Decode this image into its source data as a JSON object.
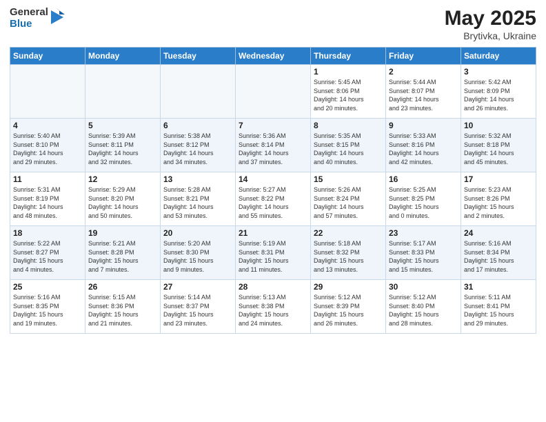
{
  "header": {
    "logo": {
      "general": "General",
      "blue": "Blue"
    },
    "title": "May 2025",
    "location": "Brytivka, Ukraine"
  },
  "weekdays": [
    "Sunday",
    "Monday",
    "Tuesday",
    "Wednesday",
    "Thursday",
    "Friday",
    "Saturday"
  ],
  "weeks": [
    [
      {
        "day": "",
        "info": ""
      },
      {
        "day": "",
        "info": ""
      },
      {
        "day": "",
        "info": ""
      },
      {
        "day": "",
        "info": ""
      },
      {
        "day": "1",
        "info": "Sunrise: 5:45 AM\nSunset: 8:06 PM\nDaylight: 14 hours\nand 20 minutes."
      },
      {
        "day": "2",
        "info": "Sunrise: 5:44 AM\nSunset: 8:07 PM\nDaylight: 14 hours\nand 23 minutes."
      },
      {
        "day": "3",
        "info": "Sunrise: 5:42 AM\nSunset: 8:09 PM\nDaylight: 14 hours\nand 26 minutes."
      }
    ],
    [
      {
        "day": "4",
        "info": "Sunrise: 5:40 AM\nSunset: 8:10 PM\nDaylight: 14 hours\nand 29 minutes."
      },
      {
        "day": "5",
        "info": "Sunrise: 5:39 AM\nSunset: 8:11 PM\nDaylight: 14 hours\nand 32 minutes."
      },
      {
        "day": "6",
        "info": "Sunrise: 5:38 AM\nSunset: 8:12 PM\nDaylight: 14 hours\nand 34 minutes."
      },
      {
        "day": "7",
        "info": "Sunrise: 5:36 AM\nSunset: 8:14 PM\nDaylight: 14 hours\nand 37 minutes."
      },
      {
        "day": "8",
        "info": "Sunrise: 5:35 AM\nSunset: 8:15 PM\nDaylight: 14 hours\nand 40 minutes."
      },
      {
        "day": "9",
        "info": "Sunrise: 5:33 AM\nSunset: 8:16 PM\nDaylight: 14 hours\nand 42 minutes."
      },
      {
        "day": "10",
        "info": "Sunrise: 5:32 AM\nSunset: 8:18 PM\nDaylight: 14 hours\nand 45 minutes."
      }
    ],
    [
      {
        "day": "11",
        "info": "Sunrise: 5:31 AM\nSunset: 8:19 PM\nDaylight: 14 hours\nand 48 minutes."
      },
      {
        "day": "12",
        "info": "Sunrise: 5:29 AM\nSunset: 8:20 PM\nDaylight: 14 hours\nand 50 minutes."
      },
      {
        "day": "13",
        "info": "Sunrise: 5:28 AM\nSunset: 8:21 PM\nDaylight: 14 hours\nand 53 minutes."
      },
      {
        "day": "14",
        "info": "Sunrise: 5:27 AM\nSunset: 8:22 PM\nDaylight: 14 hours\nand 55 minutes."
      },
      {
        "day": "15",
        "info": "Sunrise: 5:26 AM\nSunset: 8:24 PM\nDaylight: 14 hours\nand 57 minutes."
      },
      {
        "day": "16",
        "info": "Sunrise: 5:25 AM\nSunset: 8:25 PM\nDaylight: 15 hours\nand 0 minutes."
      },
      {
        "day": "17",
        "info": "Sunrise: 5:23 AM\nSunset: 8:26 PM\nDaylight: 15 hours\nand 2 minutes."
      }
    ],
    [
      {
        "day": "18",
        "info": "Sunrise: 5:22 AM\nSunset: 8:27 PM\nDaylight: 15 hours\nand 4 minutes."
      },
      {
        "day": "19",
        "info": "Sunrise: 5:21 AM\nSunset: 8:28 PM\nDaylight: 15 hours\nand 7 minutes."
      },
      {
        "day": "20",
        "info": "Sunrise: 5:20 AM\nSunset: 8:30 PM\nDaylight: 15 hours\nand 9 minutes."
      },
      {
        "day": "21",
        "info": "Sunrise: 5:19 AM\nSunset: 8:31 PM\nDaylight: 15 hours\nand 11 minutes."
      },
      {
        "day": "22",
        "info": "Sunrise: 5:18 AM\nSunset: 8:32 PM\nDaylight: 15 hours\nand 13 minutes."
      },
      {
        "day": "23",
        "info": "Sunrise: 5:17 AM\nSunset: 8:33 PM\nDaylight: 15 hours\nand 15 minutes."
      },
      {
        "day": "24",
        "info": "Sunrise: 5:16 AM\nSunset: 8:34 PM\nDaylight: 15 hours\nand 17 minutes."
      }
    ],
    [
      {
        "day": "25",
        "info": "Sunrise: 5:16 AM\nSunset: 8:35 PM\nDaylight: 15 hours\nand 19 minutes."
      },
      {
        "day": "26",
        "info": "Sunrise: 5:15 AM\nSunset: 8:36 PM\nDaylight: 15 hours\nand 21 minutes."
      },
      {
        "day": "27",
        "info": "Sunrise: 5:14 AM\nSunset: 8:37 PM\nDaylight: 15 hours\nand 23 minutes."
      },
      {
        "day": "28",
        "info": "Sunrise: 5:13 AM\nSunset: 8:38 PM\nDaylight: 15 hours\nand 24 minutes."
      },
      {
        "day": "29",
        "info": "Sunrise: 5:12 AM\nSunset: 8:39 PM\nDaylight: 15 hours\nand 26 minutes."
      },
      {
        "day": "30",
        "info": "Sunrise: 5:12 AM\nSunset: 8:40 PM\nDaylight: 15 hours\nand 28 minutes."
      },
      {
        "day": "31",
        "info": "Sunrise: 5:11 AM\nSunset: 8:41 PM\nDaylight: 15 hours\nand 29 minutes."
      }
    ]
  ]
}
